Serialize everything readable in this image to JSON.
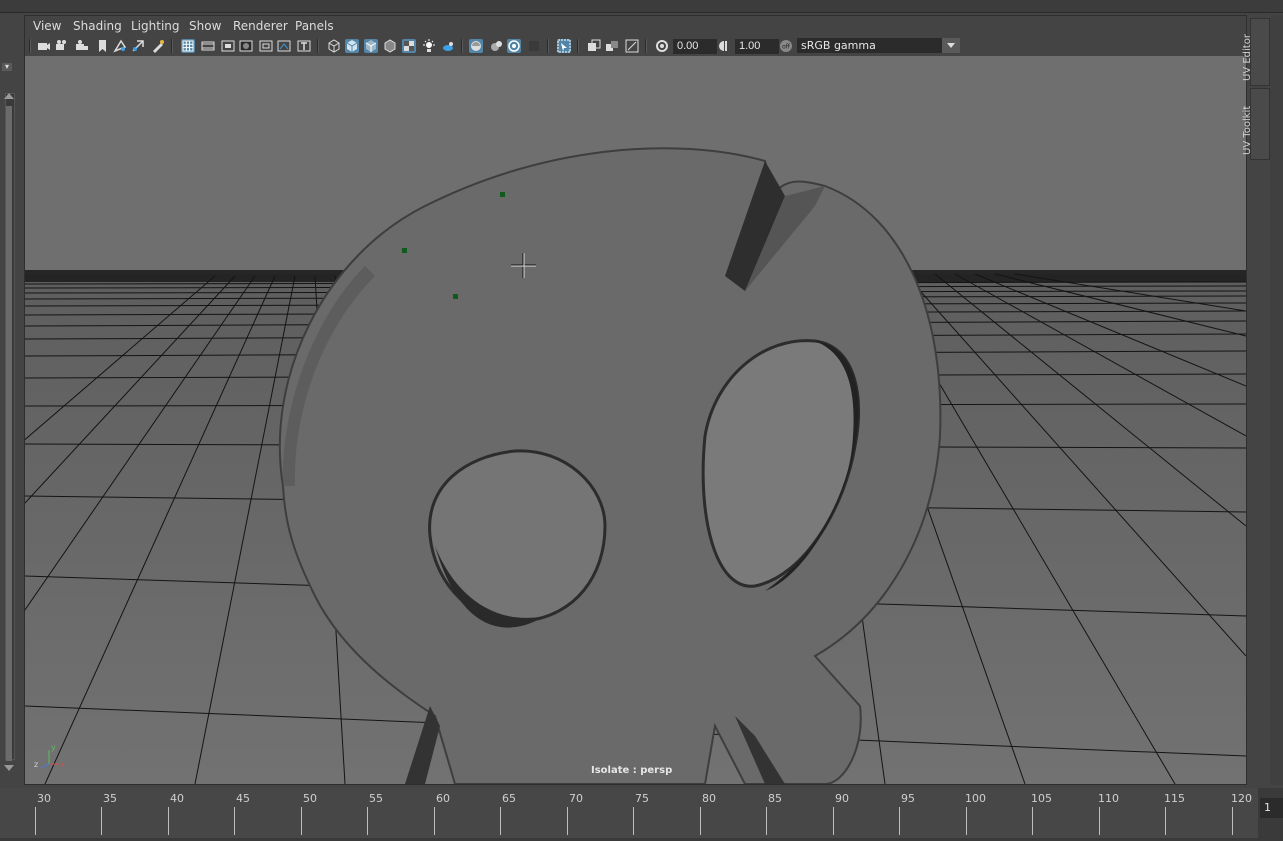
{
  "menu": {
    "items": [
      "View",
      "Shading",
      "Lighting",
      "Show",
      "Renderer",
      "Panels"
    ]
  },
  "toolbar": {
    "exposure_value": "0.00",
    "gamma_value": "1.00",
    "color_space": "sRGB gamma",
    "icons": [
      "select-camera-icon",
      "camera-attributes-icon",
      "bookmark-icon",
      "image-plane-icon",
      "grid-icon",
      "film-gate-icon",
      "resolution-gate-icon",
      "gate-mask-icon",
      "field-chart-icon",
      "safe-action-icon",
      "safe-title-icon",
      "wireframe-icon",
      "smooth-shade-icon",
      "wireframe-on-shaded-icon",
      "textured-icon",
      "use-lights-icon",
      "shadows-icon",
      "ambient-occlusion-icon",
      "motion-blur-icon",
      "anti-aliasing-icon",
      "depth-of-field-icon",
      "isolate-select-icon",
      "xray-icon",
      "xray-joints-icon",
      "backface-culling-icon",
      "exposure-icon",
      "gamma-icon",
      "view-transform-icon"
    ]
  },
  "viewport": {
    "isolate_label": "Isolate : persp",
    "axis": {
      "y": "y",
      "z": "z",
      "x": "x"
    },
    "background_color": "#6e6e6e",
    "grid_color": "#111111",
    "mesh_color": "#6a6a6a"
  },
  "side_tabs": {
    "uv_editor": "UV Editor",
    "uv_toolkit": "UV Toolkit"
  },
  "timeline": {
    "ticks": [
      "30",
      "35",
      "40",
      "45",
      "50",
      "55",
      "60",
      "65",
      "70",
      "75",
      "80",
      "85",
      "90",
      "95",
      "100",
      "105",
      "110",
      "115",
      "120"
    ],
    "current_frame": "1"
  }
}
